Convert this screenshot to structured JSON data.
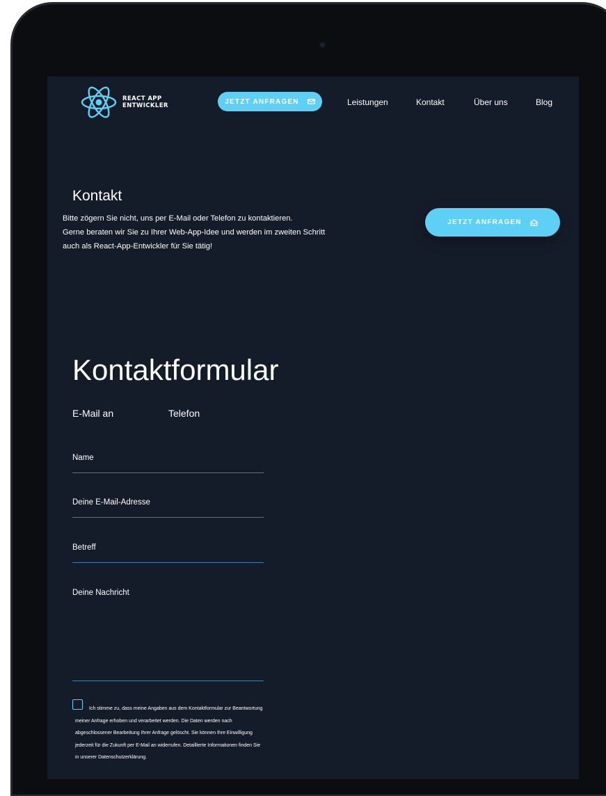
{
  "header": {
    "logo_line1": "REACT APP",
    "logo_line2": "ENTWICKLER",
    "cta_label": "JETZT ANFRAGEN",
    "nav": [
      "Leistungen",
      "Kontakt",
      "Über uns",
      "Blog"
    ]
  },
  "intro": {
    "title": "Kontakt",
    "lines": [
      "Bitte zögern Sie nicht, uns per E-Mail oder Telefon zu kontaktieren.",
      "Gerne beraten wir Sie zu Ihrer Web-App-Idee und werden im zweiten Schritt",
      "auch als React-App-Entwickler für Sie tätig!"
    ],
    "cta_label": "JETZT ANFRAGEN"
  },
  "form": {
    "title": "Kontaktformular",
    "tabs": [
      "E-Mail an",
      "Telefon"
    ],
    "fields": {
      "name": "Name",
      "email": "Deine E-Mail-Adresse",
      "subject": "Betreff",
      "message": "Deine Nachricht"
    },
    "consent": "Ich stimme zu, dass meine Angaben aus dem Kontaktformular zur Beantwortung meiner Anfrage erhoben und verarbeitet werden. Die Daten werden nach abgeschlossener Bearbeitung Ihrer Anfrage gelöscht. Sie können Ihre Einwilligung jederzeit für die Zukunft per E-Mail an widerrufen. Detaillierte Informationen finden Sie in unserer Datenschutzerklärung."
  },
  "colors": {
    "background": "#151c29",
    "accent": "#5fd0f5",
    "line": "#3d7ea6"
  },
  "icons": [
    "react-logo-icon",
    "mail-icon",
    "mail-open-icon"
  ]
}
